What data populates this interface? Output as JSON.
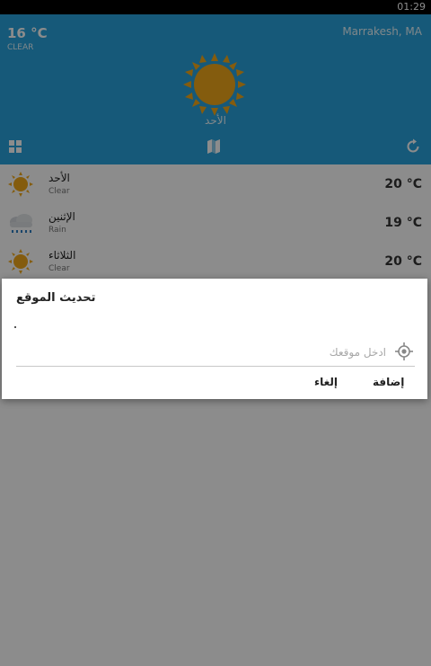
{
  "status_bar": {
    "time": "01:29"
  },
  "current": {
    "temp": "16 °C",
    "condition": "CLEAR",
    "location": "Marrakesh, MA",
    "day": "الأحد",
    "icon": "sun-icon"
  },
  "toolbar": {
    "icons": [
      "grid-icon",
      "map-icon",
      "refresh-icon"
    ]
  },
  "forecast": [
    {
      "day": "الأحد",
      "condition": "Clear",
      "temp": "20 °C",
      "icon": "sun-icon"
    },
    {
      "day": "الإثنين",
      "condition": "Rain",
      "temp": "19 °C",
      "icon": "rain-cloud-icon"
    },
    {
      "day": "الثلاثاء",
      "condition": "Clear",
      "temp": "20 °C",
      "icon": "sun-icon"
    }
  ],
  "dialog": {
    "title": "تحديث الموقع",
    "placeholder": "ادخل موقعك",
    "add_label": "إضافة",
    "cancel_label": "إلغاء"
  },
  "colors": {
    "header_bg": "#29a3dc",
    "sun": "#f0a81a",
    "overlay": "rgba(0,0,0,0.45)"
  }
}
